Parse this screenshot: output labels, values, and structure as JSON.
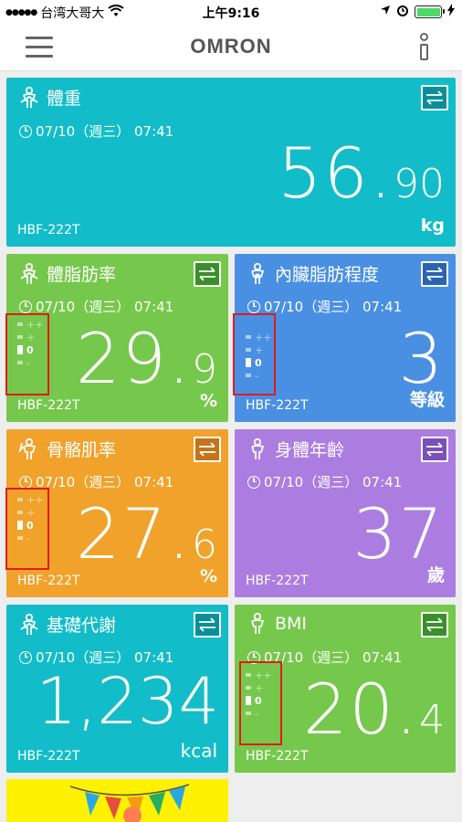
{
  "status": {
    "carrier": "台湾大哥大",
    "time": "上午9:16"
  },
  "app": {
    "brand": "OMRON"
  },
  "colors": {
    "cyan": "#12bdc9",
    "green": "#76c84c",
    "blue": "#4a90e2",
    "orange": "#f0a22a",
    "purple": "#ac7de0",
    "yellow": "#fff200",
    "highlight": "#e21b1b"
  },
  "cards": [
    {
      "title": "體重",
      "icon": "person-icon",
      "time": "07/10（週三）  07:41",
      "device": "HBF-222T",
      "value_big": "56.",
      "value_small": "90",
      "unit": "kg"
    },
    {
      "title": "體脂肪率",
      "icon": "person-icon",
      "time": "07/10（週三）  07:41",
      "device": "HBF-222T",
      "value_big": "29.",
      "value_small": "9",
      "unit": "%",
      "scale": [
        "++",
        "+",
        "0",
        "-"
      ],
      "level": "0"
    },
    {
      "title": "內臟脂肪程度",
      "icon": "person-organ-icon",
      "time": "07/10（週三）  07:41",
      "device": "HBF-222T",
      "value_big": "3",
      "value_small": "",
      "unit": "等級",
      "scale": [
        "++",
        "+",
        "0",
        "-"
      ],
      "level": "0"
    },
    {
      "title": "骨骼肌率",
      "icon": "person-arm-icon",
      "time": "07/10（週三）  07:41",
      "device": "HBF-222T",
      "value_big": "27.",
      "value_small": "6",
      "unit": "%",
      "scale": [
        "++",
        "+",
        "0",
        "-"
      ],
      "level": "0"
    },
    {
      "title": "身體年齡",
      "icon": "person-icon",
      "time": "07/10（週三）  07:41",
      "device": "HBF-222T",
      "value_big": "37",
      "value_small": "",
      "unit": "歲"
    },
    {
      "title": "基礎代謝",
      "icon": "person-icon",
      "time": "07/10（週三）  07:41",
      "device": "HBF-222T",
      "value_big": "1,234",
      "value_small": "",
      "unit": "kcal"
    },
    {
      "title": "BMI",
      "icon": "person-bmi-icon",
      "time": "07/10（週三）  07:41",
      "device": "HBF-222T",
      "value_big": "20.",
      "value_small": "4",
      "unit": "",
      "scale": [
        "++",
        "+",
        "0",
        "-"
      ],
      "level": "0"
    }
  ]
}
